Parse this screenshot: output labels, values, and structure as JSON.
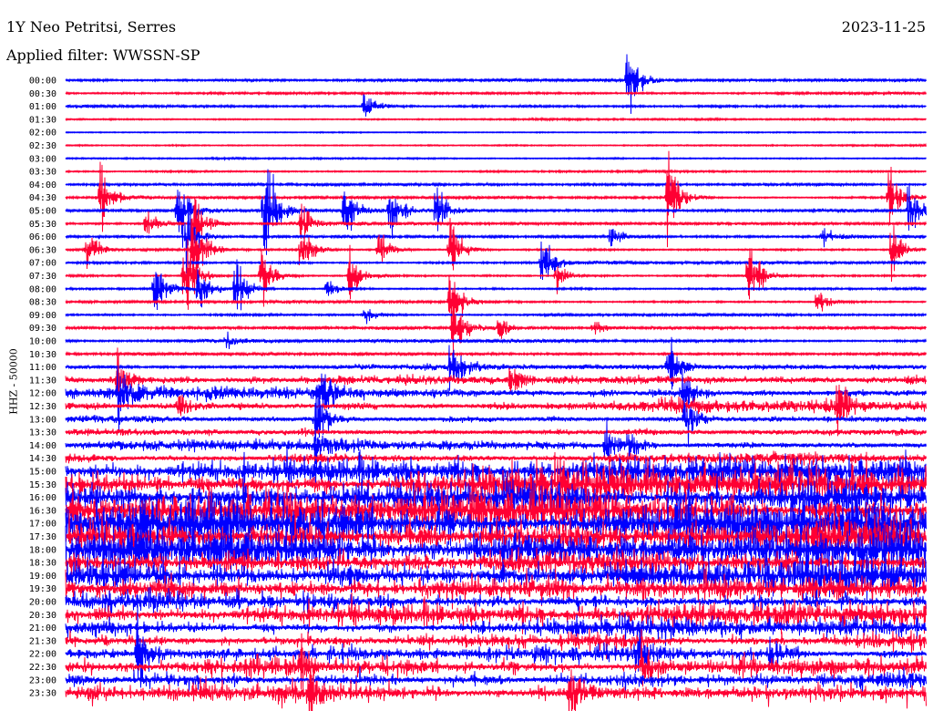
{
  "header": {
    "station": "1Y Neo Petritsi, Serres",
    "filter": "Applied filter: WWSSN-SP",
    "date": "2023-11-25"
  },
  "chart_data": {
    "type": "line",
    "title": "1Y Neo Petritsi, Serres",
    "ylabel": "HHZ - 50000",
    "minutes_per_line": 30,
    "colors": [
      "#0000ff",
      "#ff0033"
    ],
    "row_labels": [
      "00:00",
      "00:30",
      "01:00",
      "01:30",
      "02:00",
      "02:30",
      "03:00",
      "03:30",
      "04:00",
      "04:30",
      "05:00",
      "05:30",
      "06:00",
      "06:30",
      "07:00",
      "07:30",
      "08:00",
      "08:30",
      "09:00",
      "09:30",
      "10:00",
      "10:30",
      "11:00",
      "11:30",
      "12:00",
      "12:30",
      "13:00",
      "13:30",
      "14:00",
      "14:30",
      "15:00",
      "15:30",
      "16:00",
      "16:30",
      "17:00",
      "17:30",
      "18:00",
      "18:30",
      "19:00",
      "19:30",
      "20:00",
      "20:30",
      "21:00",
      "21:30",
      "22:00",
      "22:30",
      "23:00",
      "23:30"
    ],
    "noise_level": [
      0.6,
      0.5,
      0.9,
      0.3,
      0.3,
      0.3,
      0.4,
      0.4,
      0.5,
      0.5,
      0.7,
      0.6,
      0.6,
      0.6,
      0.6,
      0.6,
      0.6,
      0.6,
      0.6,
      0.6,
      0.7,
      0.6,
      1.2,
      2.5,
      3,
      3,
      2.5,
      2.5,
      2.5,
      3,
      6,
      8,
      10,
      10,
      11,
      10,
      10,
      10,
      10,
      9,
      6,
      5,
      4,
      4,
      3.5,
      4,
      4,
      4
    ],
    "events": [
      {
        "row": 0,
        "minute": 19.6,
        "amplitude": 35
      },
      {
        "row": 2,
        "minute": 10.4,
        "amplitude": 14
      },
      {
        "row": 9,
        "minute": 1.2,
        "amplitude": 30
      },
      {
        "row": 9,
        "minute": 21,
        "amplitude": 45
      },
      {
        "row": 9,
        "minute": 28.7,
        "amplitude": 30
      },
      {
        "row": 10,
        "minute": 3.9,
        "amplitude": 35
      },
      {
        "row": 10,
        "minute": 6.9,
        "amplitude": 55
      },
      {
        "row": 10,
        "minute": 9.7,
        "amplitude": 28
      },
      {
        "row": 10,
        "minute": 11.3,
        "amplitude": 25
      },
      {
        "row": 10,
        "minute": 12.9,
        "amplitude": 25
      },
      {
        "row": 10,
        "minute": 29.4,
        "amplitude": 28
      },
      {
        "row": 11,
        "minute": 2.8,
        "amplitude": 14
      },
      {
        "row": 11,
        "minute": 4.5,
        "amplitude": 28
      },
      {
        "row": 11,
        "minute": 8.2,
        "amplitude": 20
      },
      {
        "row": 12,
        "minute": 4.2,
        "amplitude": 25
      },
      {
        "row": 12,
        "minute": 19,
        "amplitude": 10
      },
      {
        "row": 12,
        "minute": 26.4,
        "amplitude": 10
      },
      {
        "row": 13,
        "minute": 0.7,
        "amplitude": 20
      },
      {
        "row": 13,
        "minute": 4.4,
        "amplitude": 40
      },
      {
        "row": 13,
        "minute": 8.2,
        "amplitude": 28
      },
      {
        "row": 13,
        "minute": 10.9,
        "amplitude": 14
      },
      {
        "row": 13,
        "minute": 13.4,
        "amplitude": 25
      },
      {
        "row": 13,
        "minute": 28.8,
        "amplitude": 25
      },
      {
        "row": 14,
        "minute": 16.6,
        "amplitude": 30
      },
      {
        "row": 15,
        "minute": 4.1,
        "amplitude": 40
      },
      {
        "row": 15,
        "minute": 6.8,
        "amplitude": 25
      },
      {
        "row": 15,
        "minute": 9.9,
        "amplitude": 25
      },
      {
        "row": 15,
        "minute": 17.1,
        "amplitude": 14
      },
      {
        "row": 15,
        "minute": 23.8,
        "amplitude": 35
      },
      {
        "row": 16,
        "minute": 3.1,
        "amplitude": 30
      },
      {
        "row": 16,
        "minute": 4.6,
        "amplitude": 25
      },
      {
        "row": 16,
        "minute": 5.9,
        "amplitude": 25
      },
      {
        "row": 16,
        "minute": 9.1,
        "amplitude": 10
      },
      {
        "row": 17,
        "minute": 13.4,
        "amplitude": 30
      },
      {
        "row": 17,
        "minute": 26.2,
        "amplitude": 12
      },
      {
        "row": 18,
        "minute": 10.4,
        "amplitude": 8
      },
      {
        "row": 19,
        "minute": 13.5,
        "amplitude": 30
      },
      {
        "row": 19,
        "minute": 15.1,
        "amplitude": 8
      },
      {
        "row": 19,
        "minute": 18.4,
        "amplitude": 8
      },
      {
        "row": 20,
        "minute": 5.6,
        "amplitude": 8
      },
      {
        "row": 22,
        "minute": 13.4,
        "amplitude": 25
      },
      {
        "row": 22,
        "minute": 21,
        "amplitude": 25
      },
      {
        "row": 23,
        "minute": 1.8,
        "amplitude": 20
      },
      {
        "row": 23,
        "minute": 15.5,
        "amplitude": 12
      },
      {
        "row": 24,
        "minute": 1.8,
        "amplitude": 25
      },
      {
        "row": 24,
        "minute": 8.8,
        "amplitude": 30
      },
      {
        "row": 24,
        "minute": 21.5,
        "amplitude": 20
      },
      {
        "row": 25,
        "minute": 3.9,
        "amplitude": 15
      },
      {
        "row": 25,
        "minute": 26.9,
        "amplitude": 20
      },
      {
        "row": 26,
        "minute": 8.7,
        "amplitude": 25
      },
      {
        "row": 26,
        "minute": 21.6,
        "amplitude": 25
      },
      {
        "row": 28,
        "minute": 8.7,
        "amplitude": 18
      },
      {
        "row": 28,
        "minute": 18.8,
        "amplitude": 20
      },
      {
        "row": 28,
        "minute": 19.6,
        "amplitude": 20
      },
      {
        "row": 44,
        "minute": 2.5,
        "amplitude": 30
      },
      {
        "row": 44,
        "minute": 19.9,
        "amplitude": 20
      },
      {
        "row": 44,
        "minute": 24.5,
        "amplitude": 20
      },
      {
        "row": 45,
        "minute": 8.2,
        "amplitude": 15
      },
      {
        "row": 45,
        "minute": 20.1,
        "amplitude": 25
      },
      {
        "row": 47,
        "minute": 8.5,
        "amplitude": 20
      },
      {
        "row": 47,
        "minute": 17.6,
        "amplitude": 20
      }
    ]
  }
}
